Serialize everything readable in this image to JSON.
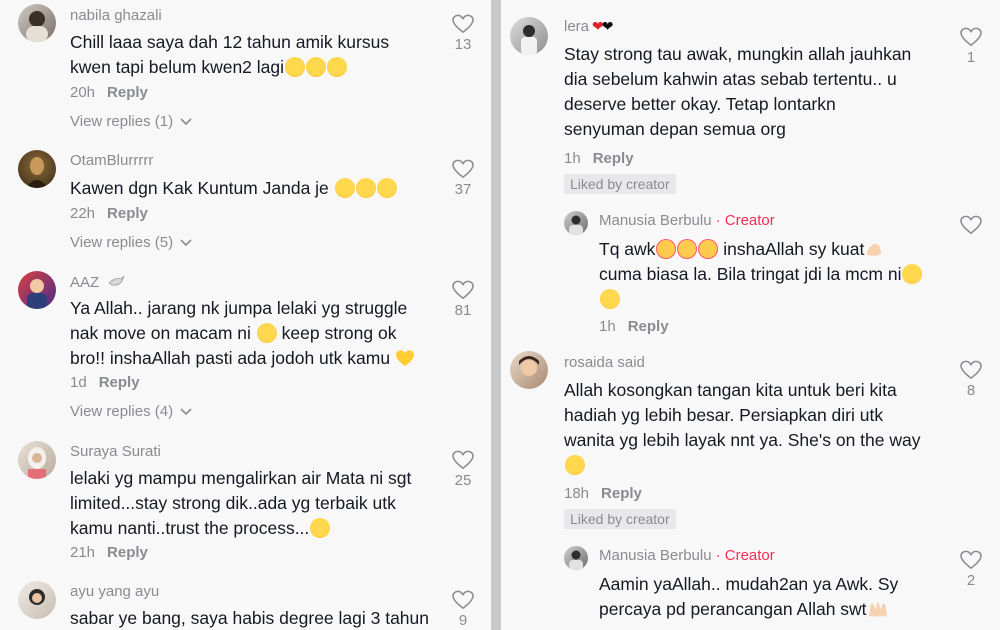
{
  "left_comments": [
    {
      "user": "nabila ghazali",
      "text": "Chill laaa saya dah 12 tahun amik kursus kwen tapi belum kwen2 lagi",
      "time": "20h",
      "reply": "Reply",
      "view_replies": "View replies (1)",
      "likes": "13"
    },
    {
      "user": "OtamBlurrrrr",
      "text": "Kawen dgn Kak Kuntum Janda je",
      "time": "22h",
      "reply": "Reply",
      "view_replies": "View replies (5)",
      "likes": "37"
    },
    {
      "user": "AAZ",
      "text_l1": "Ya Allah.. jarang nk jumpa lelaki yg struggle",
      "text_l2": "nak move on macam ni",
      "text_l2b": "keep strong ok",
      "text_l3": "bro!! inshaAllah pasti ada jodoh utk kamu",
      "time": "1d",
      "reply": "Reply",
      "view_replies": "View replies (4)",
      "likes": "81"
    },
    {
      "user": "Suraya Surati",
      "text_l1": "lelaki yg mampu mengalirkan air Mata ni sgt",
      "text_l2": "limited...stay strong dik..ada yg terbaik utk",
      "text_l3": "kamu nanti..trust the process...",
      "time": "21h",
      "reply": "Reply",
      "likes": "25"
    },
    {
      "user": "ayu yang ayu",
      "text": "sabar ye bang, saya habis degree lagi 3 tahun",
      "likes": "9"
    }
  ],
  "right_comments": [
    {
      "user": "lera",
      "text_l1": "Stay strong tau awak, mungkin allah jauhkan",
      "text_l2": "dia sebelum kahwin atas sebab tertentu.. u",
      "text_l3": "deserve better okay. Tetap lontarkn",
      "text_l4": "senyuman depan semua org",
      "time": "1h",
      "reply": "Reply",
      "liked_by": "Liked by creator",
      "likes": "1"
    },
    {
      "user": "Manusia Berbulu",
      "creator": "Creator",
      "text_l1a": "Tq awk",
      "text_l1b": "inshaAllah sy kuat",
      "text_l2": "cuma biasa la. Bila tringat jdi la mcm ni",
      "time": "1h",
      "reply": "Reply"
    },
    {
      "user": "rosaida said",
      "text_l1": "Allah kosongkan tangan kita untuk beri kita",
      "text_l2": "hadiah yg lebih besar. Persiapkan diri utk",
      "text_l3": "wanita yg lebih layak nnt ya. She's on the way",
      "time": "18h",
      "reply": "Reply",
      "liked_by": "Liked by creator",
      "likes": "8"
    },
    {
      "user": "Manusia Berbulu",
      "creator": "Creator",
      "text_l1": "Aamin yaAllah.. mudah2an ya Awk. Sy",
      "text_l2": "percaya pd perancangan Allah swt",
      "likes": "2"
    }
  ],
  "colors": {
    "creator": "#fe2c55",
    "muted": "#8a8b91",
    "text": "#161823"
  }
}
